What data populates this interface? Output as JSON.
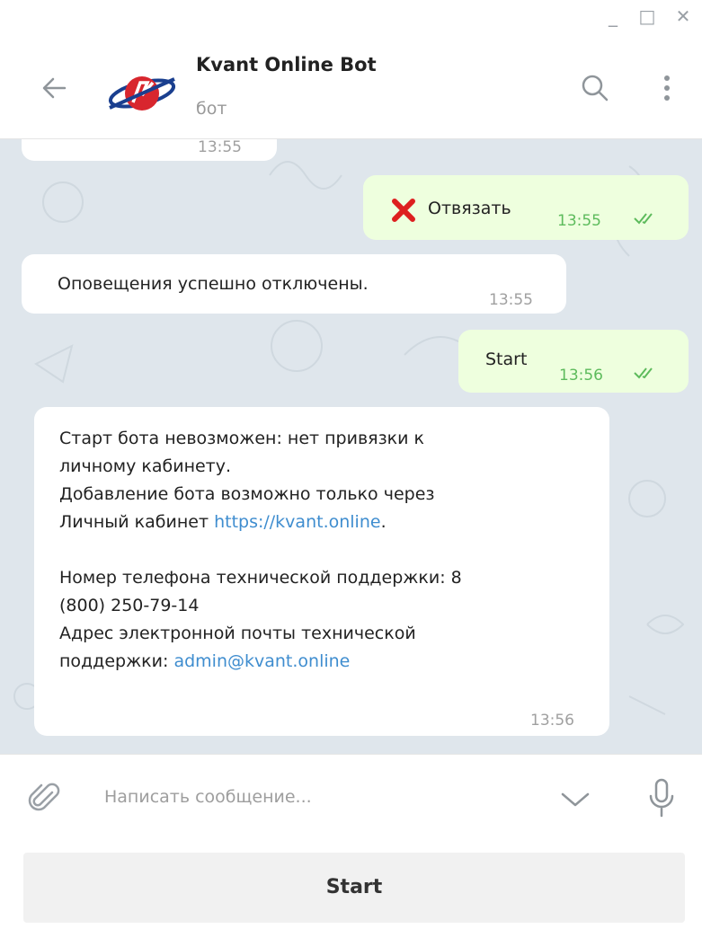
{
  "window": {
    "minimize": "_",
    "maximize": "□",
    "close": "✕"
  },
  "header": {
    "title": "Kvant Online Bot",
    "subtitle": "бот"
  },
  "messages": {
    "partial_time": "13:55",
    "m1": {
      "text": "Отвязать",
      "time": "13:55"
    },
    "m2": {
      "text": "Оповещения успешно отключены.",
      "time": "13:55"
    },
    "m3": {
      "text": "Start",
      "time": "13:56"
    },
    "m4": {
      "line1": "Старт бота невозможен: нет привязки к",
      "line2": "личному кабинету.",
      "line3": "Добавление бота возможно только через",
      "line4_prefix": "Личный кабинет ",
      "line4_link": "https://kvant.online",
      "line4_suffix": ".",
      "line5": "Номер телефона технической поддержки: 8",
      "line6": "(800) 250-79-14",
      "line7": "Адрес электронной почты технической",
      "line8_prefix": "поддержки: ",
      "line8_link": "admin@kvant.online",
      "time": "13:56"
    }
  },
  "composer": {
    "placeholder": "Написать сообщение..."
  },
  "keyboard": {
    "start_label": "Start"
  },
  "colors": {
    "accent_link": "#3f8dcf",
    "outgoing_bg": "#eeffde",
    "chat_bg": "#dfe6ec",
    "read_ticks": "#5dbb5c"
  },
  "icons": [
    "back-arrow-icon",
    "search-icon",
    "more-vert-icon",
    "attach-icon",
    "chevron-down-icon",
    "mic-icon",
    "cross-mark-icon",
    "double-check-icon"
  ]
}
